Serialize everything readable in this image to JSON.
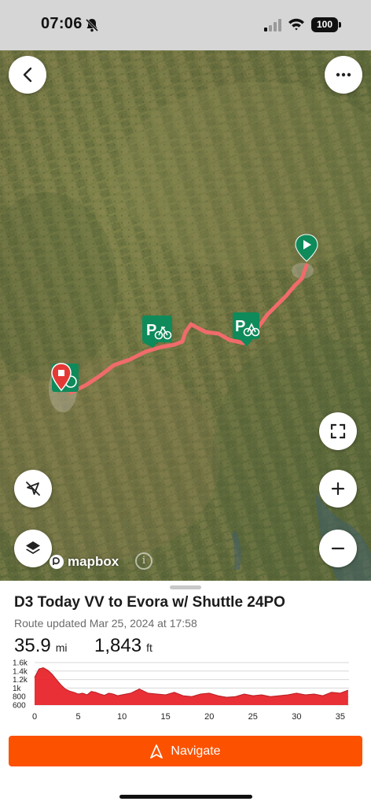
{
  "status_bar": {
    "time": "07:06",
    "battery": "100",
    "icons": [
      "bell-slash-icon",
      "cellular-signal-icon",
      "wifi-icon",
      "battery-icon"
    ]
  },
  "map": {
    "attribution_logo": "mapbox",
    "attribution_info": "i",
    "controls": [
      "back-icon",
      "more-icon",
      "fullscreen-icon",
      "compass-icon",
      "zoom-in-icon",
      "layers-icon",
      "zoom-out-icon"
    ],
    "markers": [
      "start-marker",
      "parking-bike-marker",
      "parking-bike-marker",
      "end-marker"
    ],
    "colors": {
      "route": "#f06b6b",
      "marker_green": "#0f8a5a",
      "marker_red": "#e53935"
    }
  },
  "route": {
    "title": "D3 Today VV to Evora w/ Shuttle 24PO",
    "updated": "Route updated Mar 25, 2024 at 17:58",
    "distance_value": "35.9",
    "distance_unit": "mi",
    "elevation_value": "1,843",
    "elevation_unit": "ft"
  },
  "chart_data": {
    "type": "area",
    "x": [
      0,
      0.5,
      1,
      1.5,
      2,
      2.5,
      3,
      3.5,
      4,
      4.5,
      5,
      5.5,
      6,
      6.5,
      7,
      7.5,
      8,
      8.5,
      9,
      9.5,
      10,
      11,
      12,
      13,
      14,
      15,
      16,
      17,
      18,
      19,
      20,
      21,
      22,
      23,
      24,
      25,
      26,
      27,
      28,
      29,
      30,
      31,
      32,
      33,
      34,
      35,
      35.9
    ],
    "y": [
      1250,
      1450,
      1480,
      1420,
      1330,
      1200,
      1080,
      980,
      930,
      900,
      860,
      880,
      840,
      920,
      900,
      860,
      830,
      880,
      860,
      820,
      840,
      880,
      980,
      880,
      860,
      840,
      900,
      820,
      800,
      860,
      880,
      820,
      780,
      800,
      860,
      820,
      840,
      800,
      820,
      840,
      880,
      840,
      860,
      820,
      900,
      880,
      950
    ],
    "xlim": [
      0,
      36
    ],
    "ylim": [
      600,
      1600
    ],
    "xticks": [
      "0",
      "5",
      "10",
      "15",
      "20",
      "25",
      "30",
      "35"
    ],
    "yticks": [
      "1.6k",
      "1.4k",
      "1.2k",
      "1k",
      "800",
      "600"
    ],
    "xlabel": "",
    "ylabel": "",
    "grid": true,
    "fill_color": "#e8252b"
  },
  "navigate": {
    "label": "Navigate",
    "icon": "navigation-arrow-icon"
  }
}
